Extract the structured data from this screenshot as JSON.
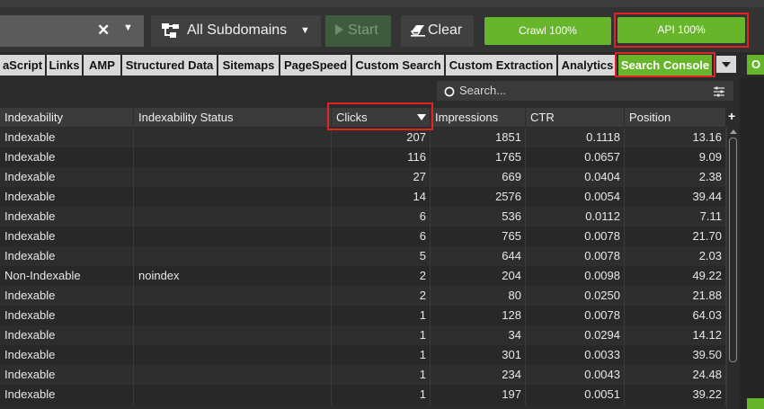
{
  "toolbar": {
    "url_clear_icon": "close-icon",
    "subdomains_label": "All Subdomains",
    "start_label": "Start",
    "clear_label": "Clear",
    "crawl_label": "Crawl 100%",
    "api_label": "API 100%",
    "accent_green": "#67b52a",
    "highlight_red": "#e02424"
  },
  "tabs": [
    {
      "label": "aScript",
      "active": false
    },
    {
      "label": "Links",
      "active": false
    },
    {
      "label": "AMP",
      "active": false
    },
    {
      "label": "Structured Data",
      "active": false
    },
    {
      "label": "Sitemaps",
      "active": false
    },
    {
      "label": "PageSpeed",
      "active": false
    },
    {
      "label": "Custom Search",
      "active": false
    },
    {
      "label": "Custom Extraction",
      "active": false
    },
    {
      "label": "Analytics",
      "active": false
    },
    {
      "label": "Search Console",
      "active": true
    }
  ],
  "tab_extra_label": "O",
  "search": {
    "placeholder": "Search..."
  },
  "table": {
    "columns": [
      "Indexability",
      "Indexability Status",
      "Clicks",
      "Impressions",
      "CTR",
      "Position"
    ],
    "sorted_column": "Clicks",
    "rows": [
      [
        "Indexable",
        "",
        "207",
        "1851",
        "0.1118",
        "13.16"
      ],
      [
        "Indexable",
        "",
        "116",
        "1765",
        "0.0657",
        "9.09"
      ],
      [
        "Indexable",
        "",
        "27",
        "669",
        "0.0404",
        "2.38"
      ],
      [
        "Indexable",
        "",
        "14",
        "2576",
        "0.0054",
        "39.44"
      ],
      [
        "Indexable",
        "",
        "6",
        "536",
        "0.0112",
        "7.11"
      ],
      [
        "Indexable",
        "",
        "6",
        "765",
        "0.0078",
        "21.70"
      ],
      [
        "Indexable",
        "",
        "5",
        "644",
        "0.0078",
        "2.03"
      ],
      [
        "Non-Indexable",
        "noindex",
        "2",
        "204",
        "0.0098",
        "49.22"
      ],
      [
        "Indexable",
        "",
        "2",
        "80",
        "0.0250",
        "21.88"
      ],
      [
        "Indexable",
        "",
        "1",
        "128",
        "0.0078",
        "64.03"
      ],
      [
        "Indexable",
        "",
        "1",
        "34",
        "0.0294",
        "14.12"
      ],
      [
        "Indexable",
        "",
        "1",
        "301",
        "0.0033",
        "39.50"
      ],
      [
        "Indexable",
        "",
        "1",
        "234",
        "0.0043",
        "24.48"
      ],
      [
        "Indexable",
        "",
        "1",
        "197",
        "0.0051",
        "39.22"
      ]
    ]
  }
}
